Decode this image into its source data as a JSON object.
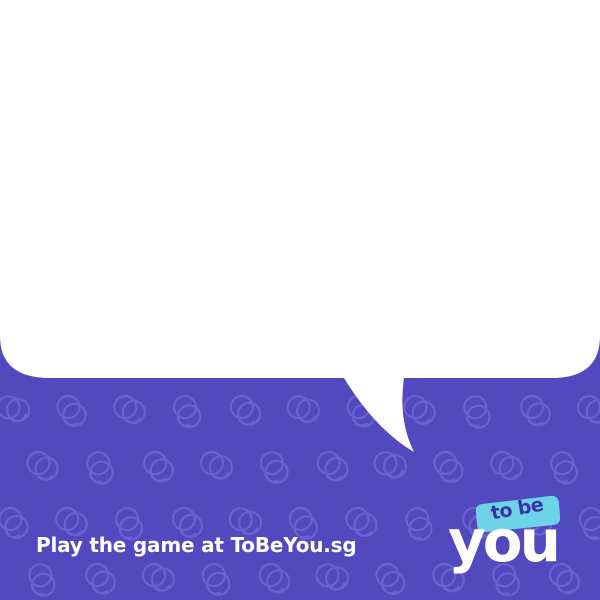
{
  "cta_text": "Play the game at ToBeYou.sg",
  "logo": {
    "tag": "to be",
    "word": "you"
  },
  "colors": {
    "background": "#5249bf",
    "pattern": "#6a62d2",
    "bubble": "#ffffff",
    "logo_tag": "#6fd3e8",
    "text": "#ffffff"
  },
  "icons": [
    "speech-bubble",
    "doodle-pattern",
    "brand-logo"
  ]
}
